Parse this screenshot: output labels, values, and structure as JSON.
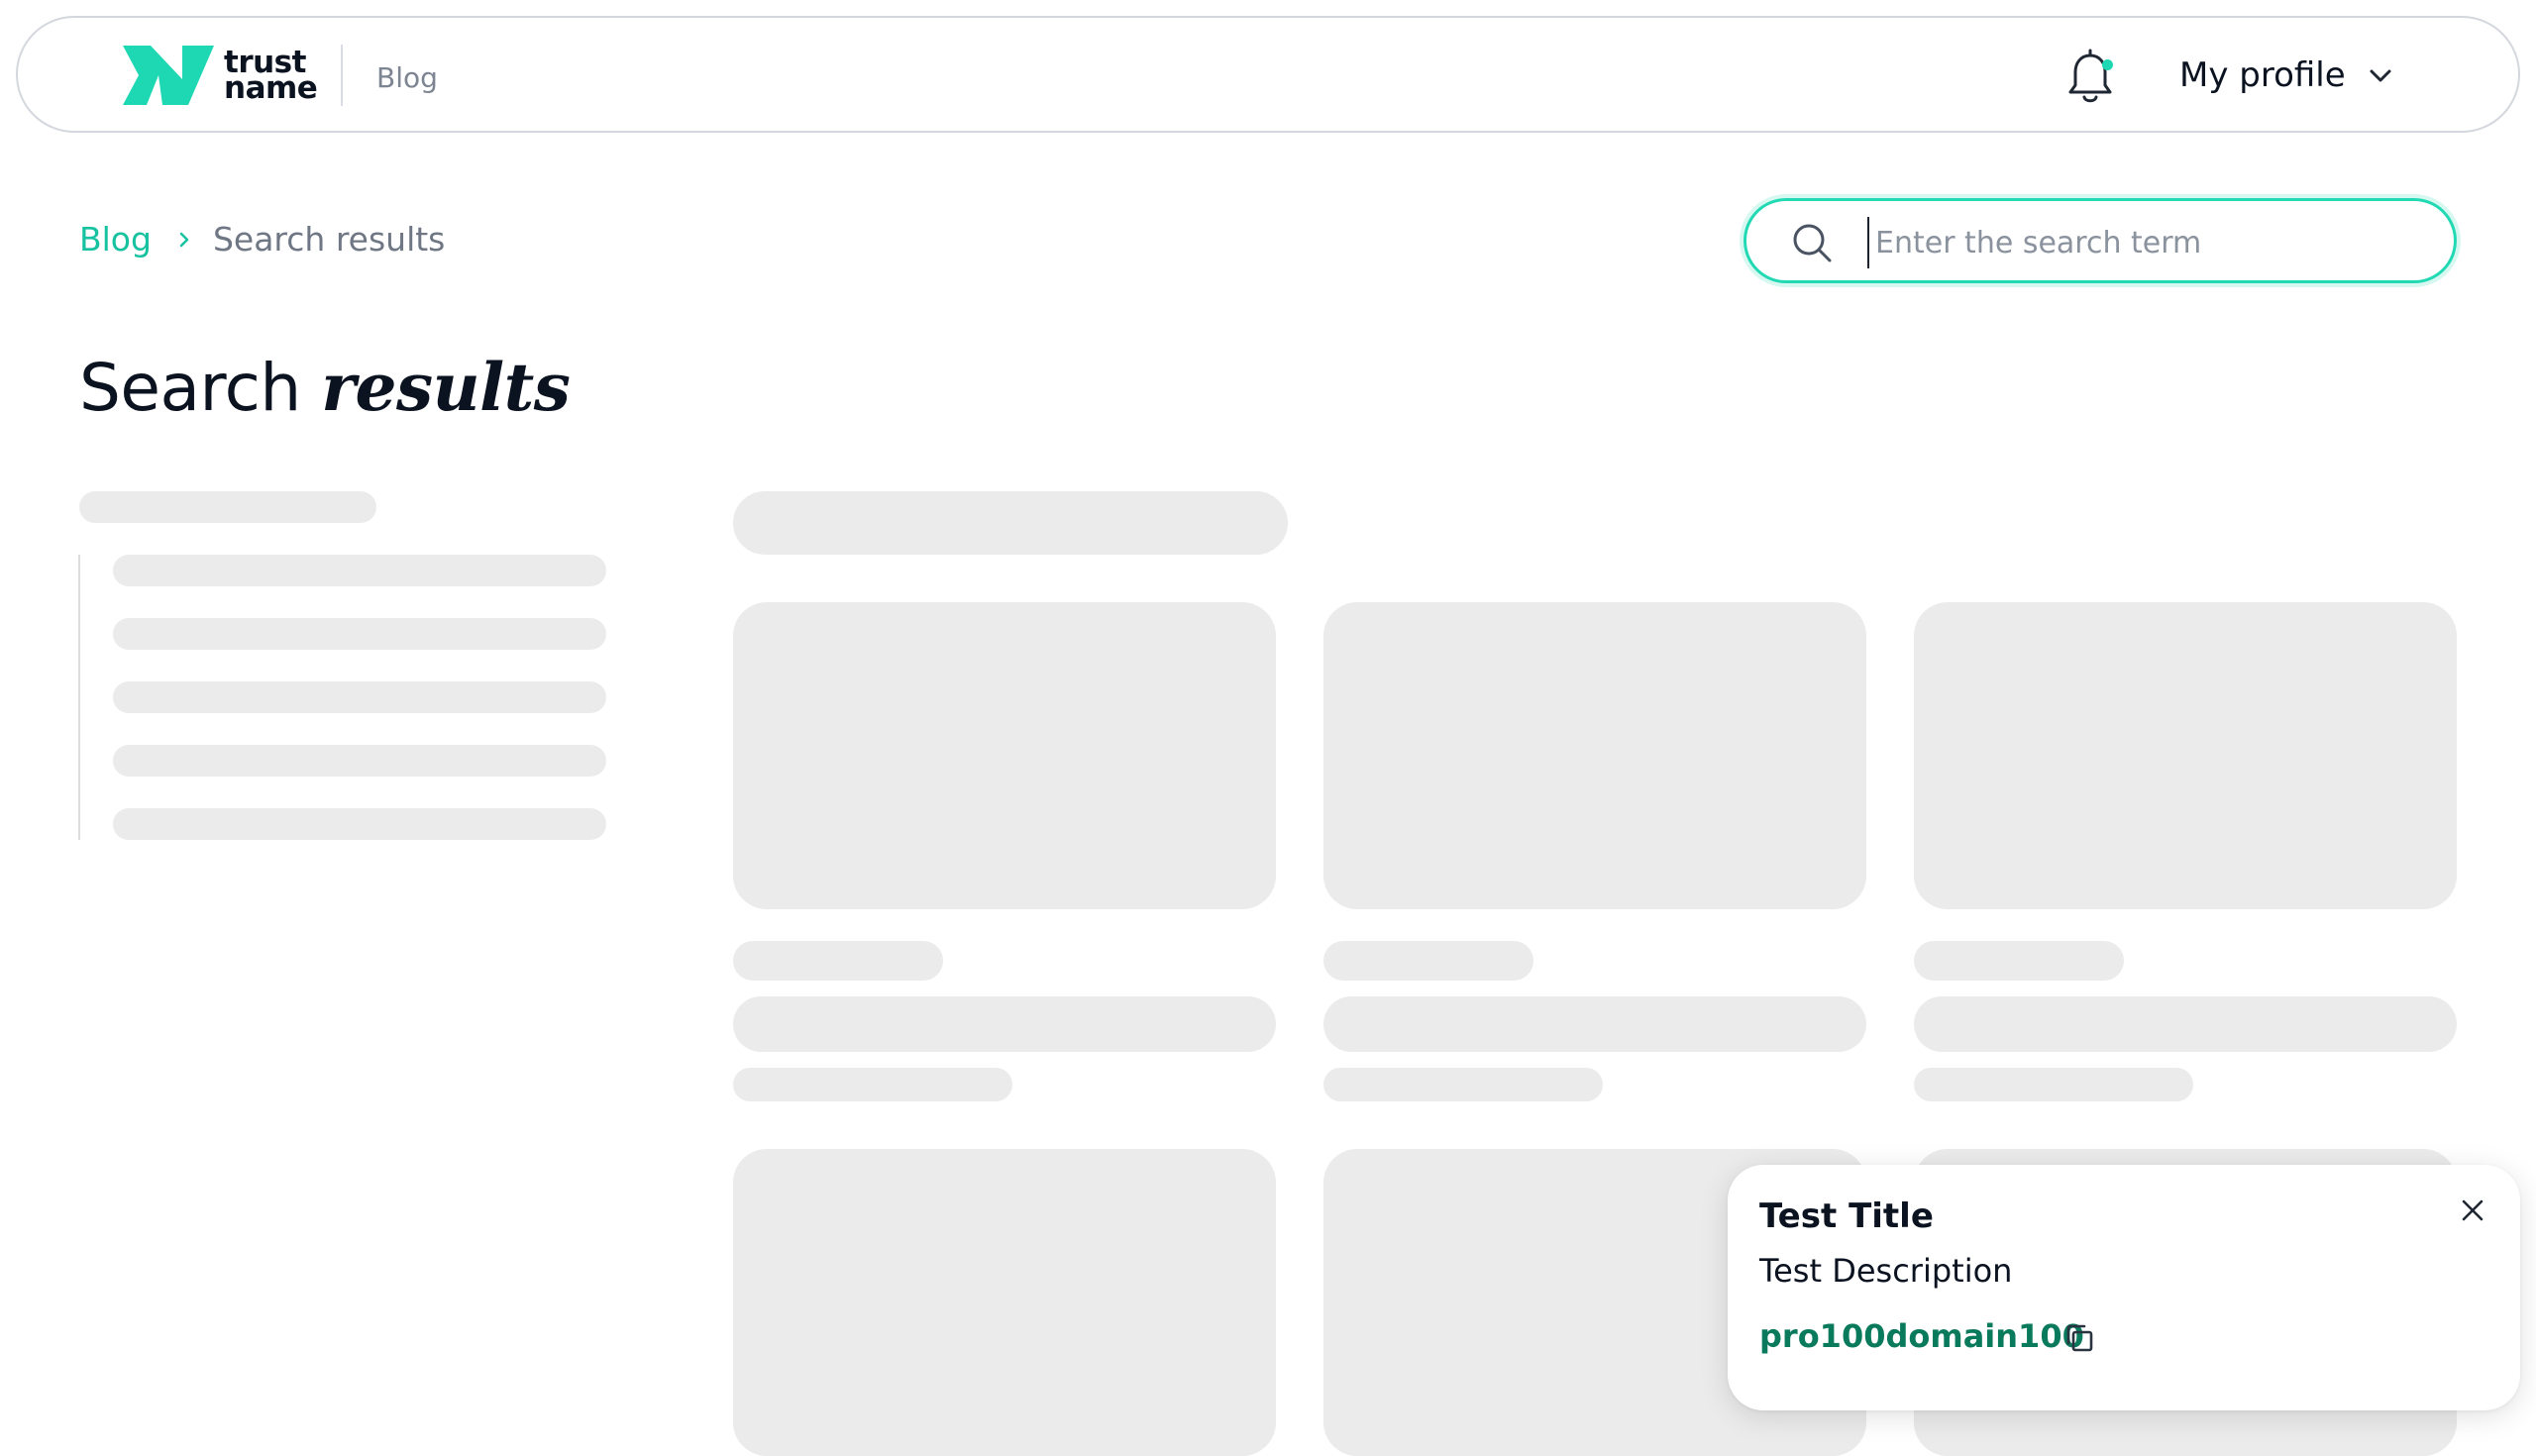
{
  "header": {
    "logo_line1": "trust",
    "logo_line2": "name",
    "section_label": "Blog",
    "profile_label": "My profile",
    "notification_dot_color": "#1ed8b3"
  },
  "breadcrumb": {
    "items": [
      {
        "label": "Blog"
      },
      {
        "label": "Search results"
      }
    ]
  },
  "search": {
    "placeholder": "Enter the search term",
    "value": ""
  },
  "page": {
    "title_regular": "Search",
    "title_emphasis": "results"
  },
  "toast": {
    "title": "Test Title",
    "description": "Test Description",
    "code": "pro100domain100"
  },
  "icons": {
    "bell": "bell-icon",
    "chevron": "chevron-down-icon",
    "breadcrumb_separator": "chevron-right-icon",
    "search": "search-icon",
    "copy": "copy-icon",
    "close": "close-icon"
  },
  "colors": {
    "accent": "#16c2a0",
    "search_border": "#22d9b4",
    "code_text": "#0a7a5c",
    "skeleton": "#ebebeb"
  }
}
